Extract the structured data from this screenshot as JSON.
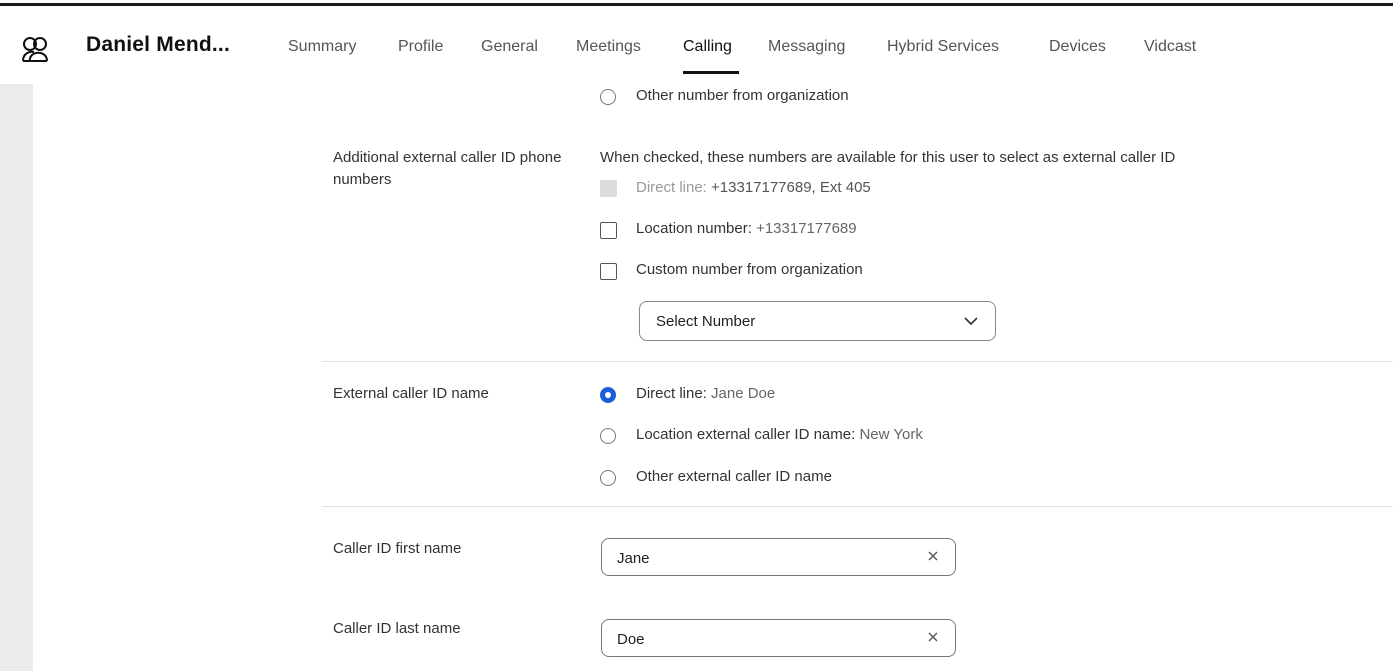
{
  "header": {
    "user_name": "Daniel Mend...",
    "tabs": [
      {
        "label": "Summary"
      },
      {
        "label": "Profile"
      },
      {
        "label": "General"
      },
      {
        "label": "Meetings"
      },
      {
        "label": "Calling",
        "active": true
      },
      {
        "label": "Messaging"
      },
      {
        "label": "Hybrid Services"
      },
      {
        "label": "Devices"
      },
      {
        "label": "Vidcast"
      }
    ]
  },
  "caller_id_number": {
    "other_org_label": "Other number from organization"
  },
  "additional": {
    "label": "Additional external caller ID phone numbers",
    "description": "When checked, these numbers are available for this user to select as external caller ID",
    "direct_line_label": "Direct line:",
    "direct_line_value": "+13317177689, Ext 405",
    "location_label": "Location number:",
    "location_value": "+13317177689",
    "custom_label": "Custom number from organization",
    "select_placeholder": "Select Number"
  },
  "external_name": {
    "label": "External caller ID name",
    "direct_line_label": "Direct line:",
    "direct_line_value": "Jane Doe",
    "location_label": "Location external caller ID name:",
    "location_value": "New York",
    "other_label": "Other external caller ID name"
  },
  "first_name": {
    "label": "Caller ID first name",
    "value": "Jane"
  },
  "last_name": {
    "label": "Caller ID last name",
    "value": "Doe"
  },
  "colors": {
    "accent": "#1a5ed6",
    "sidebar": "#ebebeb"
  }
}
